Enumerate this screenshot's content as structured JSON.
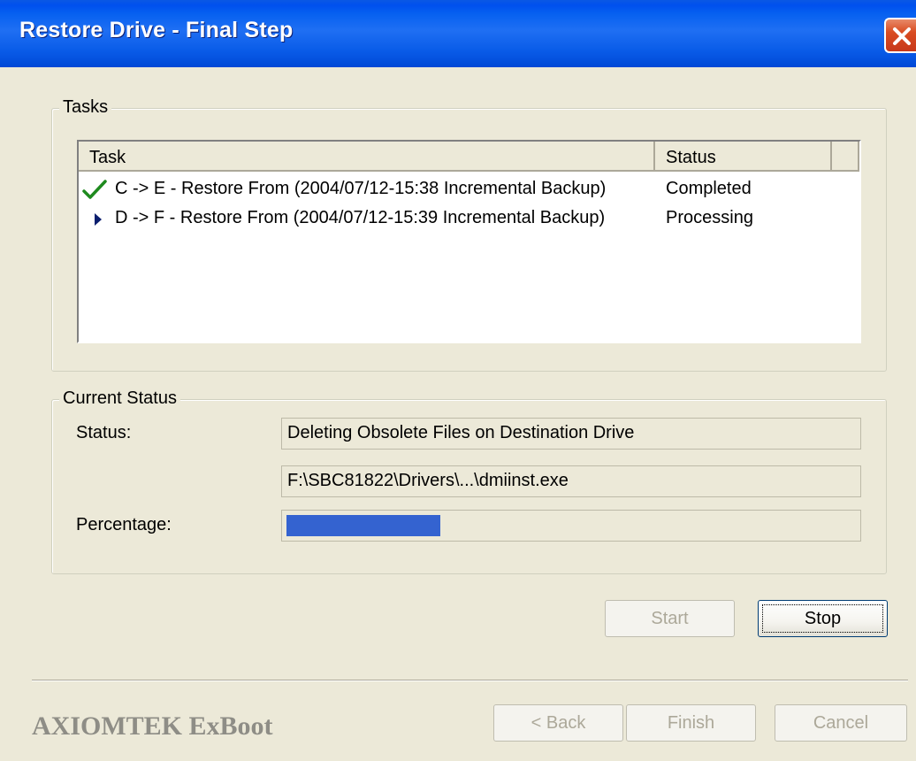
{
  "window": {
    "title": "Restore Drive - Final Step"
  },
  "tasks_group": {
    "label": "Tasks",
    "columns": [
      "Task",
      "Status"
    ],
    "rows": [
      {
        "icon": "checkmark-icon",
        "task": "C -> E - Restore From (2004/07/12-15:38 Incremental Backup)",
        "status": "Completed"
      },
      {
        "icon": "play-arrow-icon",
        "task": "D -> F - Restore From (2004/07/12-15:39 Incremental Backup)",
        "status": "Processing"
      }
    ]
  },
  "current_status": {
    "label": "Current Status",
    "status_label": "Status:",
    "status_value": "Deleting Obsolete Files on Destination Drive",
    "file_value": "F:\\SBC81822\\Drivers\\...\\dmiinst.exe",
    "percentage_label": "Percentage:",
    "progress_fraction": 0.27
  },
  "buttons": {
    "start": "Start",
    "stop": "Stop",
    "back": "< Back",
    "finish": "Finish",
    "cancel": "Cancel"
  },
  "brand": "AXIOMTEK ExBoot",
  "colors": {
    "title_bar": "#0A5CE8",
    "progress_fill": "#3463D0",
    "check_green": "#1E8A1E",
    "dialog_bg": "#ECE9D8"
  }
}
